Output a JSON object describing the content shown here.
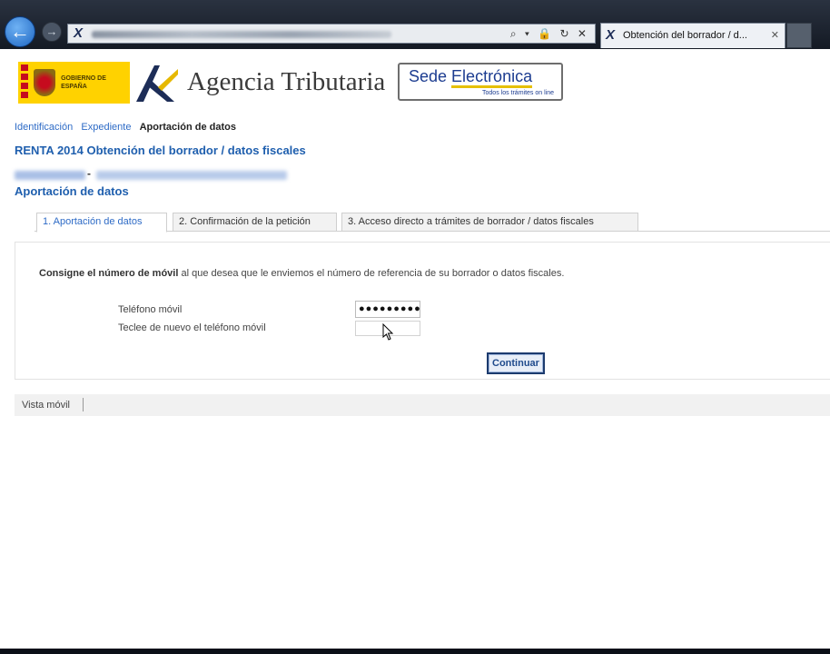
{
  "browser": {
    "tab_title": "Obtención del borrador / d...",
    "tab_close": "✕",
    "address_icons": "⌕ ▾ 🔒 ↻ ✕"
  },
  "header": {
    "gov_logo_text": "Gobierno de España",
    "agency_name": "Agencia Tributaria",
    "sede_title_part1": "Sede ",
    "sede_title_part2": "Electrónica",
    "sede_subtitle": "Todos los trámites on line"
  },
  "breadcrumb": {
    "items": [
      "Identificación",
      "Expediente"
    ],
    "current": "Aportación de datos"
  },
  "page": {
    "title": "RENTA 2014 Obtención del borrador / datos fiscales",
    "user_separator": "-",
    "section_title": "Aportación de datos"
  },
  "tabs": [
    {
      "label": "1. Aportación de datos",
      "active": true
    },
    {
      "label": "2. Confirmación de la petición",
      "active": false
    },
    {
      "label": "3. Acceso directo a trámites de borrador / datos fiscales",
      "active": false
    }
  ],
  "form": {
    "instruction_bold": "Consigne el número de móvil",
    "instruction_rest": " al que desea que le enviemos el número de referencia de su borrador o datos fiscales.",
    "phone_label": "Teléfono móvil",
    "phone_value": "●●●●●●●●●",
    "repeat_label": "Teclee de nuevo el teléfono móvil",
    "repeat_value": "",
    "continue_label": "Continuar"
  },
  "footer": {
    "mobile_view_label": "Vista móvil"
  }
}
